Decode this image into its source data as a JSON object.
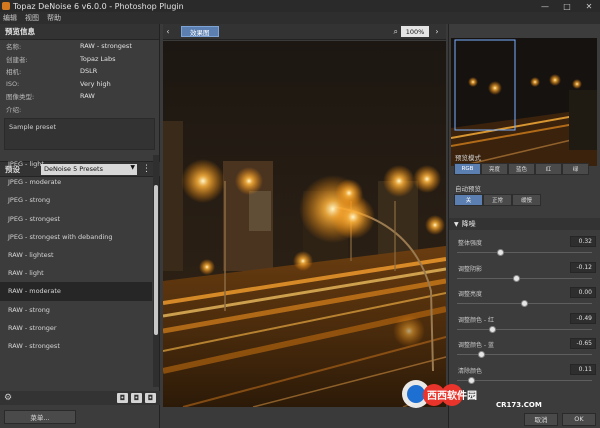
{
  "window": {
    "title": "Topaz DeNoise 6 v6.0.0 - Photoshop Plugin",
    "minimize": "—",
    "maximize": "□",
    "close": "✕"
  },
  "menu": [
    "编辑",
    "视图",
    "帮助"
  ],
  "preview_info": {
    "heading": "预览信息",
    "rows": [
      {
        "key": "名称:",
        "value": "RAW - strongest"
      },
      {
        "key": "创建者:",
        "value": "Topaz Labs"
      },
      {
        "key": "相机:",
        "value": "DSLR"
      },
      {
        "key": "ISO:",
        "value": "Very high"
      },
      {
        "key": "图像类型:",
        "value": "RAW"
      },
      {
        "key": "介绍:",
        "value": ""
      }
    ],
    "description": "Sample preset"
  },
  "presets": {
    "heading": "预设",
    "selector": "DeNoise 5 Presets",
    "selected_index": 9,
    "items": [
      "JPEG - light",
      "JPEG - moderate",
      "JPEG - strong",
      "JPEG - strongest",
      "JPEG - strongest with debanding",
      "RAW - lightest",
      "RAW - light",
      "RAW - moderate",
      "RAW - strong",
      "RAW - stronger",
      "RAW - strongest"
    ],
    "highlight_index": 7
  },
  "footer": {
    "menu_button": "菜单...",
    "cancel": "取消",
    "ok": "OK"
  },
  "viewer": {
    "mode_button": "效果图",
    "zoom": "100%"
  },
  "right_panel": {
    "preview_mode_label": "预览模式",
    "preview_modes": [
      "RGB",
      "亮度",
      "蓝色",
      "红",
      "绿"
    ],
    "auto_preview_label": "自动预览",
    "auto_preview_modes": [
      "关",
      "正常",
      "缓慢"
    ],
    "denoise_heading": "降噪",
    "params": [
      {
        "name": "整体强度",
        "value": "0.32",
        "fraction": 0.32
      },
      {
        "name": "调整阴影",
        "value": "-0.12",
        "fraction": 0.44
      },
      {
        "name": "调整亮度",
        "value": "0.00",
        "fraction": 0.5
      },
      {
        "name": "调整颜色 - 红",
        "value": "-0.49",
        "fraction": 0.26
      },
      {
        "name": "调整颜色 - 蓝",
        "value": "-0.65",
        "fraction": 0.18
      },
      {
        "name": "清除颜色",
        "value": "0.11",
        "fraction": 0.11
      }
    ]
  },
  "watermark": {
    "brand": "西西软件园",
    "domain": "CR173.COM"
  },
  "colors": {
    "accent": "#5b7fb0",
    "panel": "#3c3c3c",
    "header": "#333333",
    "light": "#ffb43c"
  }
}
